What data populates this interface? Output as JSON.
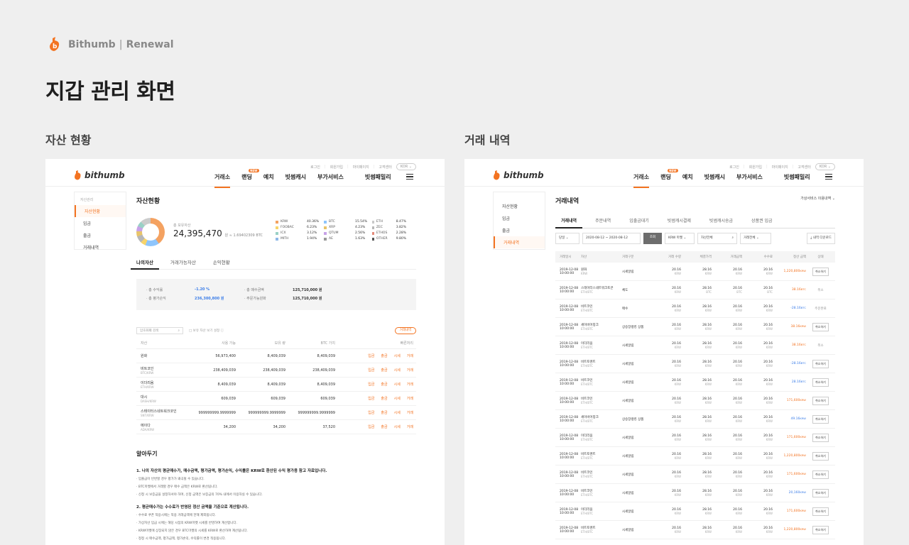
{
  "brand": {
    "name": "Bithumb",
    "sep": "|",
    "sub": "Renewal"
  },
  "page_title": "지갑 관리 화면",
  "sections": {
    "left": "자산 현황",
    "right": "거래 내역"
  },
  "header": {
    "logo_text": "bithumb",
    "topnav": [
      "로그인",
      "회원가입",
      "마이페이지",
      "고객센터"
    ],
    "lang": "KOR ⌄",
    "nav": [
      "거래소",
      "랜딩",
      "예치",
      "빗썸캐시",
      "부가서비스",
      "빗썸패밀리"
    ],
    "new_badge": "NEW"
  },
  "left": {
    "side_title": "자산관리",
    "side_items": [
      "자산현황",
      "입금",
      "출금",
      "거래내역"
    ],
    "title": "자산현황",
    "total_label": "총 보유자산",
    "total_value": "24,395,470",
    "total_unit": "원 ≈ 1.69402309 BTC",
    "legend": [
      {
        "name": "KRW",
        "pct": "40.36%",
        "color": "#f4a261"
      },
      {
        "name": "BTC",
        "pct": "15.54%",
        "color": "#8ec5fc"
      },
      {
        "name": "ETH",
        "pct": "8.47%",
        "color": "#c9c9c9"
      },
      {
        "name": "FOOBAC",
        "pct": "6.23%",
        "color": "#f7d46a"
      },
      {
        "name": "XRP",
        "pct": "4.23%",
        "color": "#e8c46a"
      },
      {
        "name": "ZEC",
        "pct": "3.82%",
        "color": "#b7b7b7"
      },
      {
        "name": "ICX",
        "pct": "3.12%",
        "color": "#9ad1c6"
      },
      {
        "name": "QTUM",
        "pct": "2.56%",
        "color": "#c8a2e8"
      },
      {
        "name": "ETHOS",
        "pct": "2.28%",
        "color": "#e58a7a"
      },
      {
        "name": "MITH",
        "pct": "1.94%",
        "color": "#8fb8e8"
      },
      {
        "name": "AE",
        "pct": "1.63%",
        "color": "#999999"
      },
      {
        "name": "OTHER",
        "pct": "9.80%",
        "color": "#555555"
      }
    ],
    "tabs": [
      "나의자산",
      "거래가능자산",
      "손익현황"
    ],
    "profit": {
      "rate_label": "· 총 수익률",
      "rate_value": "-1.20 %",
      "eval_label": "· 총 평가손익",
      "eval_value": "236,300,800 원",
      "buy_label": "· 총 매수금액",
      "buy_value": "125,710,000 원",
      "order_label": "· 주문가능원화",
      "order_value": "125,710,000 원"
    },
    "search_placeholder": "암호화폐 검색",
    "check_label": "□ 보유 자산 보기 설정 ⓘ",
    "history_button": "거래내역",
    "table_headers": [
      "자산",
      "사용 가능",
      "보유 량",
      "BTC 가치",
      "빠른처리"
    ],
    "rows": [
      {
        "name": "원화",
        "pair": "",
        "a": "56,973,400",
        "b": "8,409,039",
        "c": "8,409,039"
      },
      {
        "name": "비트코인",
        "pair": "BTC/KRW",
        "a": "238,409,039",
        "b": "238,409,039",
        "c": "238,409,039"
      },
      {
        "name": "이더리움",
        "pair": "ETH/KRW",
        "a": "8,409,039",
        "b": "8,409,039",
        "c": "8,409,039"
      },
      {
        "name": "대시",
        "pair": "DASH/KRW",
        "a": "609,039",
        "b": "609,039",
        "c": "609,039"
      },
      {
        "name": "스테이터스네트워크코인",
        "pair": "SNT/KRW",
        "a": "999999999.9999999",
        "b": "999999999.9999999",
        "c": "999999999.9999999"
      },
      {
        "name": "에이다",
        "pair": "ADA/KRW",
        "a": "34,200",
        "b": "34,200",
        "c": "37,520"
      }
    ],
    "actions": [
      "입금",
      "출금",
      "시세",
      "거래"
    ],
    "notice_title": "알아두기",
    "notice": [
      "1. 나의 자산의 평균매수가, 매수금액, 평가금액, 평가손익, 수익률은 KRW로 환산된 수익 평가용 참고 자료입니다.",
      "· 입출금이 빈번할 경우 평가가 왜곡될 수 있습니다.",
      "· BTC마켓에서 거래할 경우 매수 금액은 KRW로 환산됩니다.",
      "· 신청 시 보증금을 설정하셔야 하며, 신청 금액은 보증금의 70% 내에서 이용하실 수 있습니다.",
      "2. 평균매수가는 수수료가 반영된 정산 금액을 기준으로 계산됩니다.",
      "· 수수료 쿠폰 적용시에는 적용 거래금액에 한해 제외됩니다.",
      "· 가상자산 입금 시에는 해당 시점의 KRW마켓 시세를 반영하여 계산합니다.",
      "· KRW마켓에 상장되지 않은 경우 BTC마켓의 시세를 KRW로 환산하여 계산됩니다.",
      "· 정정 시 매수금액, 평가금액, 평가손익, 수익률이 변경 적용됩니다."
    ]
  },
  "right": {
    "side_title": "",
    "side_items": [
      "자산현황",
      "입금",
      "출금",
      "거래내역"
    ],
    "title": "거래내역",
    "select": "가상서비스 이용내역 ⌄",
    "tabs": [
      "거래내역",
      "주문내역",
      "입출금대기",
      "빗썸캐시결제",
      "빗썸캐시송금",
      "상품권 입금"
    ],
    "filters": [
      "당일 ⌄",
      "2020-08-12  ~  2020-08-12",
      "조회",
      "KRW 마켓 ⌄",
      "자산전체",
      "거래전체 ⌄",
      "⤓ 내역 다운로드"
    ],
    "headers": [
      "거래일시",
      "자산",
      "거래구분",
      "거래 수량",
      "체결가격",
      "거래금액",
      "수수료",
      "정산 금액",
      "상태"
    ],
    "rows": [
      {
        "date": "2019-12-08 10:00:00",
        "coin": "원화",
        "unit": "KRW",
        "kind": "시세알림",
        "q": "20.16",
        "qu": "KRW",
        "p": "28.16",
        "pu": "KRW",
        "t": "20.16",
        "tu": "KRW",
        "f": "20.16",
        "fu": "KRW",
        "s": "1,220,800",
        "su": "KRW",
        "sc": "orange",
        "st": "취소하기",
        "btn": true
      },
      {
        "date": "2019-12-08 10:00:00",
        "coin": "스테이터스네트워크토큰",
        "unit": "ETH/BTC",
        "kind": "체도",
        "q": "20.16",
        "qu": "KRW",
        "p": "28.16",
        "pu": "BTC",
        "t": "20.16",
        "tu": "BTC",
        "f": "20.16",
        "fu": "BTC",
        "s": "38.16",
        "su": "BTC",
        "sc": "orange",
        "st": "취소",
        "btn": false
      },
      {
        "date": "2019-12-08 10:00:00",
        "coin": "비트코인",
        "unit": "ETH/BTC",
        "kind": "매수",
        "q": "20.16",
        "qu": "KRW",
        "p": "28.16",
        "pu": "KRW",
        "t": "20.16",
        "tu": "KRW",
        "f": "20.16",
        "fu": "KRW",
        "s": "-28.16",
        "su": "BTC",
        "sc": "blue",
        "st": "주문완료",
        "btn": false
      },
      {
        "date": "2019-12-08 10:00:00",
        "coin": "세이비어칭크",
        "unit": "ETH/BTC",
        "kind": "상승장랭킹 상품",
        "q": "20.16",
        "qu": "KRW",
        "p": "28.16",
        "pu": "KRW",
        "t": "20.16",
        "tu": "KRW",
        "f": "20.16",
        "fu": "KRW",
        "s": "38.16",
        "su": "KRW",
        "sc": "orange",
        "st": "취소하기",
        "btn": true
      },
      {
        "date": "2019-12-08 10:00:00",
        "coin": "이더리움",
        "unit": "ETH/BTC",
        "kind": "시세알림",
        "q": "20.16",
        "qu": "KRW",
        "p": "28.16",
        "pu": "KRW",
        "t": "20.16",
        "tu": "KRW",
        "f": "20.16",
        "fu": "KRW",
        "s": "38.16",
        "su": "BTC",
        "sc": "orange",
        "st": "취소",
        "btn": false
      },
      {
        "date": "2019-12-08 10:00:00",
        "coin": "비트토렌트",
        "unit": "ETH/BTC",
        "kind": "시세알림",
        "q": "20.16",
        "qu": "KRW",
        "p": "28.16",
        "pu": "KRW",
        "t": "20.16",
        "tu": "KRW",
        "f": "20.16",
        "fu": "KRW",
        "s": "-28.16",
        "su": "BTC",
        "sc": "blue",
        "st": "취소하기",
        "btn": true
      },
      {
        "date": "2019-12-08 10:00:00",
        "coin": "비트코인",
        "unit": "ETH/BTC",
        "kind": "시세알림",
        "q": "20.16",
        "qu": "KRW",
        "p": "28.16",
        "pu": "KRW",
        "t": "20.16",
        "tu": "KRW",
        "f": "20.16",
        "fu": "KRW",
        "s": "28.16",
        "su": "BTC",
        "sc": "blue",
        "st": "취소하기",
        "btn": true
      },
      {
        "date": "2019-12-08 10:00:00",
        "coin": "비트코인",
        "unit": "ETH/BTC",
        "kind": "시세알림",
        "q": "20.16",
        "qu": "KRW",
        "p": "28.16",
        "pu": "KRW",
        "t": "20.16",
        "tu": "KRW",
        "f": "20.16",
        "fu": "KRW",
        "s": "171,600",
        "su": "KRW",
        "sc": "orange",
        "st": "취소하기",
        "btn": true
      },
      {
        "date": "2019-12-08 10:00:00",
        "coin": "세이비어칭크",
        "unit": "ETH/BTC",
        "kind": "상승장랭킹 상품",
        "q": "20.16",
        "qu": "KRW",
        "p": "28.16",
        "pu": "KRW",
        "t": "20.16",
        "tu": "KRW",
        "f": "20.16",
        "fu": "KRW",
        "s": "49.16",
        "su": "KRW",
        "sc": "blue",
        "st": "취소하기",
        "btn": true
      },
      {
        "date": "2019-12-08 10:00:00",
        "coin": "이더리움",
        "unit": "ETH/BTC",
        "kind": "시세알림",
        "q": "20.16",
        "qu": "KRW",
        "p": "28.16",
        "pu": "KRW",
        "t": "20.16",
        "tu": "KRW",
        "f": "20.16",
        "fu": "KRW",
        "s": "171,600",
        "su": "KRW",
        "sc": "orange",
        "st": "취소하기",
        "btn": true
      },
      {
        "date": "2019-12-08 10:00:00",
        "coin": "비트토렌트",
        "unit": "ETH/BTC",
        "kind": "시세알림",
        "q": "20.16",
        "qu": "KRW",
        "p": "28.16",
        "pu": "KRW",
        "t": "20.16",
        "tu": "KRW",
        "f": "20.16",
        "fu": "KRW",
        "s": "1,220,800",
        "su": "KRW",
        "sc": "orange",
        "st": "취소하기",
        "btn": true
      },
      {
        "date": "2019-12-08 10:00:00",
        "coin": "비트코인",
        "unit": "ETH/BTC",
        "kind": "시세알림",
        "q": "20.16",
        "qu": "KRW",
        "p": "28.16",
        "pu": "KRW",
        "t": "20.16",
        "tu": "KRW",
        "f": "20.16",
        "fu": "KRW",
        "s": "171,600",
        "su": "KRW",
        "sc": "orange",
        "st": "취소하기",
        "btn": true
      },
      {
        "date": "2019-12-08 10:00:00",
        "coin": "비트코인",
        "unit": "ETH/BTC",
        "kind": "시세알림",
        "q": "20.16",
        "qu": "KRW",
        "p": "28.16",
        "pu": "KRW",
        "t": "20.16",
        "tu": "KRW",
        "f": "20.16",
        "fu": "KRW",
        "s": "20,160",
        "su": "KRW",
        "sc": "blue",
        "st": "취소하기",
        "btn": true
      },
      {
        "date": "2019-12-08 10:00:00",
        "coin": "이더리움",
        "unit": "ETH/BTC",
        "kind": "시세알림",
        "q": "20.16",
        "qu": "KRW",
        "p": "28.16",
        "pu": "KRW",
        "t": "20.16",
        "tu": "KRW",
        "f": "20.16",
        "fu": "KRW",
        "s": "171,600",
        "su": "KRW",
        "sc": "orange",
        "st": "취소하기",
        "btn": true
      },
      {
        "date": "2019-12-08 10:00:00",
        "coin": "비트토렌트",
        "unit": "ETH/BTC",
        "kind": "시세알림",
        "q": "20.16",
        "qu": "KRW",
        "p": "28.16",
        "pu": "KRW",
        "t": "20.16",
        "tu": "KRW",
        "f": "20.16",
        "fu": "KRW",
        "s": "1,220,800",
        "su": "KRW",
        "sc": "orange",
        "st": "취소하기",
        "btn": true
      }
    ]
  }
}
